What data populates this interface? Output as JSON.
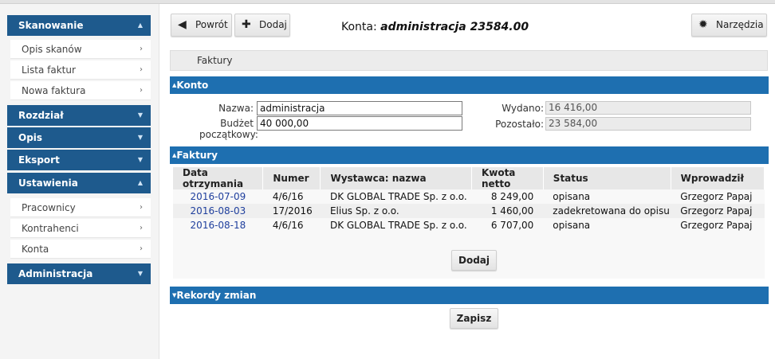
{
  "sidebar": {
    "sections": [
      {
        "label": "Skanowanie",
        "caret": "▲"
      },
      {
        "label": "Rozdział",
        "caret": "▼"
      },
      {
        "label": "Opis",
        "caret": "▼"
      },
      {
        "label": "Eksport",
        "caret": "▼"
      },
      {
        "label": "Ustawienia",
        "caret": "▲"
      },
      {
        "label": "Administracja",
        "caret": "▼"
      }
    ],
    "skanowanie_items": [
      {
        "label": "Opis skanów"
      },
      {
        "label": "Lista faktur"
      },
      {
        "label": "Nowa faktura"
      }
    ],
    "ustawienia_items": [
      {
        "label": "Pracownicy"
      },
      {
        "label": "Kontrahenci"
      },
      {
        "label": "Konta"
      }
    ],
    "item_arrow": "›"
  },
  "toolbar": {
    "back_label": "Powrót",
    "back_icon": "◀",
    "add_label": "Dodaj",
    "add_icon": "✚",
    "tools_label": "Narzędzia",
    "tools_icon": "✹"
  },
  "header": {
    "title_prefix": "Konta: ",
    "title_name": "administracja 23584.00"
  },
  "breadcrumb": "Faktury",
  "konto": {
    "section_title": "Konto",
    "nazwa_label": "Nazwa:",
    "nazwa_value": "administracja",
    "budzet_label_1": "Budżet",
    "budzet_label_2": "początkowy:",
    "budzet_value": "40 000,00",
    "wydano_label": "Wydano:",
    "wydano_value": "16 416,00",
    "pozostalo_label": "Pozostało:",
    "pozostalo_value": "23 584,00"
  },
  "faktury": {
    "section_title": "Faktury",
    "columns": [
      "Data otrzymania",
      "Numer",
      "Wystawca: nazwa",
      "Kwota netto",
      "Status",
      "Wprowadził"
    ],
    "rows": [
      {
        "date": "2016-07-09",
        "number": "4/6/16",
        "issuer": "DK GLOBAL TRADE Sp. z o.o.",
        "amount": "8 249,00",
        "status": "opisana",
        "author": "Grzegorz Papaj"
      },
      {
        "date": "2016-08-03",
        "number": "17/2016",
        "issuer": "Elius Sp. z o.o.",
        "amount": "1 460,00",
        "status": "zadekretowana do opisu",
        "author": "Grzegorz Papaj"
      },
      {
        "date": "2016-08-18",
        "number": "4/6/16",
        "issuer": "DK GLOBAL TRADE Sp. z o.o.",
        "amount": "6 707,00",
        "status": "opisana",
        "author": "Grzegorz Papaj"
      }
    ],
    "add_button": "Dodaj"
  },
  "rekordy": {
    "section_title": "Rekordy zmian"
  },
  "save_button": "Zapisz",
  "section_triangles": {
    "expanded": "▲",
    "collapsed": "▼"
  },
  "colors": {
    "sidebar_header": "#1e5a8d",
    "section_bar": "#1e6fb0",
    "link": "#1f3f9d"
  }
}
